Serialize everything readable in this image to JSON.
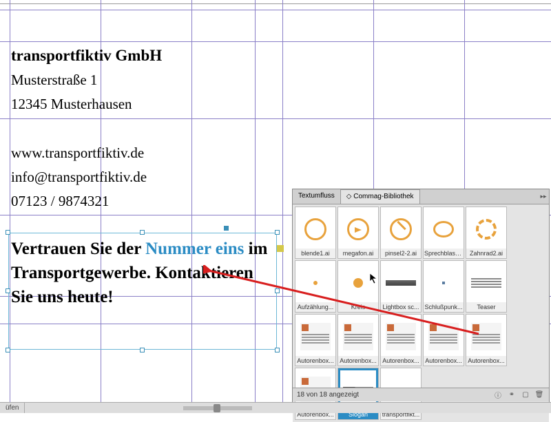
{
  "document": {
    "company": "transportfiktiv GmbH",
    "street": "Musterstraße 1",
    "city": "12345 Musterhausen",
    "web": "www.transportfiktiv.de",
    "email": "info@transportfiktiv.de",
    "phone": "07123 / 9874321",
    "slogan": {
      "part1": "Vertrauen Sie der ",
      "highlight": "Nummer eins",
      "part2": " im Transportgewerbe. Kontaktieren Sie uns heute!"
    }
  },
  "panel": {
    "tabs": {
      "textflow": "Textumfluss",
      "library": "Commag-Bibliothek"
    },
    "items": [
      {
        "label": "blende1.ai",
        "icon": "circle"
      },
      {
        "label": "megafon.ai",
        "icon": "meg"
      },
      {
        "label": "pinsel2-2.ai",
        "icon": "brush"
      },
      {
        "label": "Sprechblase.ai",
        "icon": "bubble"
      },
      {
        "label": "Zahnrad2.ai",
        "icon": "gear"
      },
      {
        "label": "Aufzählung...",
        "icon": "dot"
      },
      {
        "label": "Kreis",
        "icon": "odot"
      },
      {
        "label": "Lightbox sc...",
        "icon": "bar"
      },
      {
        "label": "Schlußpunk...",
        "icon": "sdot"
      },
      {
        "label": "Teaser",
        "icon": "lines"
      },
      {
        "label": "Autorenbox...",
        "icon": "box"
      },
      {
        "label": "Autorenbox...",
        "icon": "box"
      },
      {
        "label": "Autorenbox...",
        "icon": "box"
      },
      {
        "label": "Autorenbox...",
        "icon": "box"
      },
      {
        "label": "Autorenbox...",
        "icon": "box"
      },
      {
        "label": "Autorenbox...",
        "icon": "box"
      },
      {
        "label": "Slogan",
        "icon": "slogan",
        "selected": true
      },
      {
        "label": "transportfikt...",
        "icon": "trans"
      }
    ],
    "status": "18 von 18 angezeigt"
  },
  "bottombar": {
    "label": "üfen"
  }
}
